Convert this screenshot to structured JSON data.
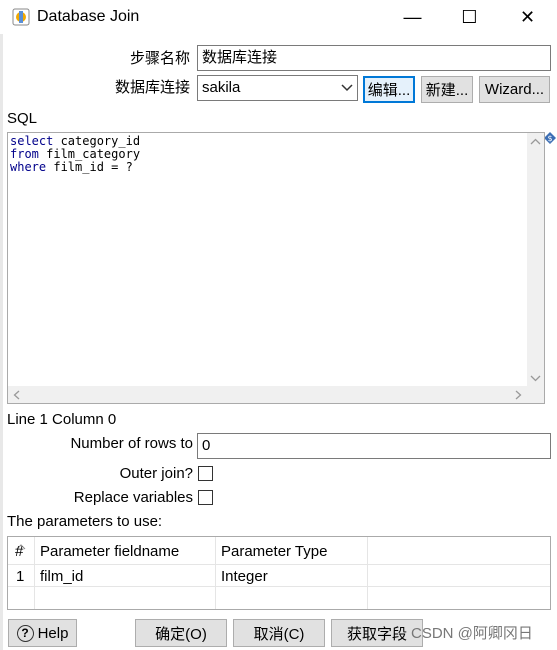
{
  "window": {
    "title": "Database Join",
    "minimize_glyph": "—",
    "maximize_glyph": "☐",
    "close_glyph": "✕"
  },
  "form": {
    "step_name_label": "步骤名称",
    "step_name_value": "数据库连接",
    "connection_label": "数据库连接",
    "connection_value": "sakila",
    "edit_button": "编辑...",
    "new_button": "新建...",
    "wizard_button": "Wizard...",
    "sql_label": "SQL",
    "sql_lines": [
      {
        "kw": "select",
        "rest": " category_id"
      },
      {
        "kw": "from",
        "rest": " film_category"
      },
      {
        "kw": "where",
        "rest": " film_id = ?"
      }
    ],
    "cursor_status": "Line 1 Column 0",
    "rows_label": "Number of rows to",
    "rows_value": "0",
    "outer_join_label": "Outer join?",
    "replace_vars_label": "Replace variables",
    "params_label": "The parameters to use:"
  },
  "params_table": {
    "headers": [
      "#",
      "Parameter fieldname",
      "Parameter Type"
    ],
    "rows": [
      {
        "num": "1",
        "field": "film_id",
        "type": "Integer"
      }
    ]
  },
  "footer": {
    "help_button": "Help",
    "ok_button": "确定(O)",
    "cancel_button": "取消(C)",
    "get_fields_button": "获取字段",
    "watermark": "CSDN @阿卿冈日"
  }
}
